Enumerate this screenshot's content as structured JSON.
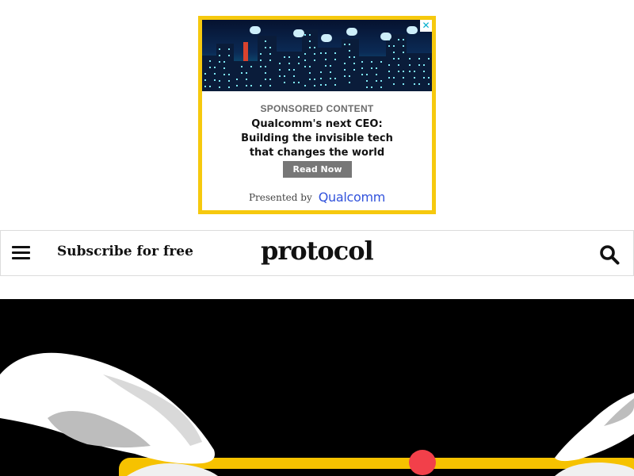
{
  "ad": {
    "close_glyph": "✕",
    "label": "SPONSORED CONTENT",
    "headline_lines": [
      "Qualcomm's next CEO:",
      "Building the invisible tech",
      "that changes the world"
    ],
    "cta": "Read Now",
    "presented_by": "Presented by",
    "sponsor": "Qualcomm",
    "border_color": "#f6c90e",
    "sponsor_color": "#3253dc"
  },
  "header": {
    "menu_icon": "hamburger-menu-icon",
    "subscribe": "Subscribe for free",
    "logo": "protocol",
    "search_icon": "search-icon"
  },
  "hero": {
    "background": "#000000",
    "accent": "#f6c200",
    "dot": "#f2404a"
  }
}
